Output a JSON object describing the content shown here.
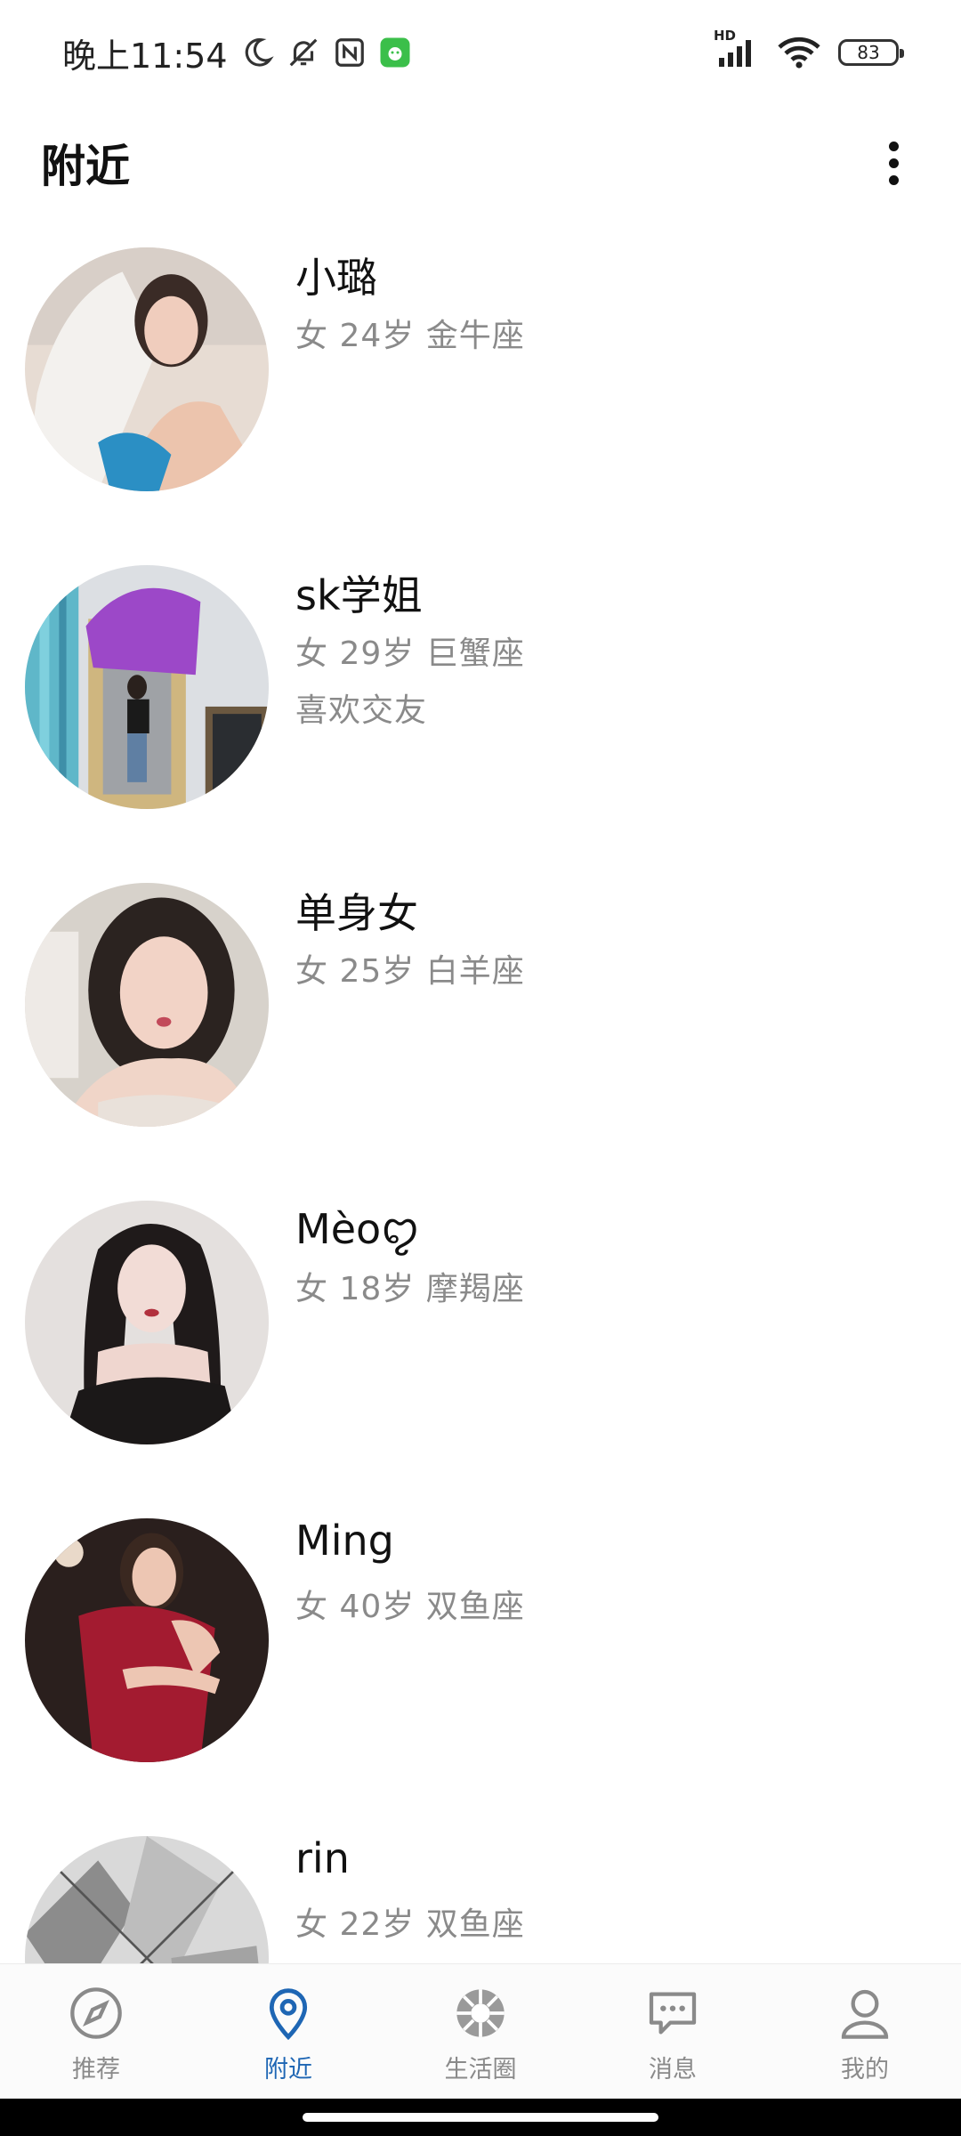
{
  "status_bar": {
    "time": "晚上11:54",
    "network_label": "HD",
    "battery_level": "83",
    "icons": [
      "moon-icon",
      "bell-off-icon",
      "nfc-icon",
      "app-notification-icon",
      "signal-icon",
      "wifi-icon",
      "battery-icon"
    ]
  },
  "header": {
    "title": "附近",
    "menu_icon": "more-vertical-icon"
  },
  "users": [
    {
      "name": "小璐",
      "meta": "女 24岁 金牛座",
      "bio": ""
    },
    {
      "name": "sk学姐",
      "meta": "女 29岁 巨蟹座",
      "bio": "喜欢交友"
    },
    {
      "name": " 单身女",
      "meta": "女 25岁 白羊座",
      "bio": ""
    },
    {
      "name": "Mèoꨄ︎",
      "meta": "女 18岁 摩羯座",
      "bio": ""
    },
    {
      "name": "Ming",
      "meta": "女 40岁 双鱼座",
      "bio": ""
    },
    {
      "name": "rin",
      "meta": "女 22岁 双鱼座",
      "bio": ""
    }
  ],
  "bottom_nav": {
    "items": [
      {
        "label": "推荐",
        "icon": "compass-icon",
        "active": false
      },
      {
        "label": "附近",
        "icon": "location-pin-icon",
        "active": true
      },
      {
        "label": "生活圈",
        "icon": "aperture-icon",
        "active": false
      },
      {
        "label": "消息",
        "icon": "chat-bubble-icon",
        "active": false
      },
      {
        "label": "我的",
        "icon": "user-icon",
        "active": false
      }
    ]
  },
  "colors": {
    "accent": "#1e66b4",
    "inactive": "#8a8a8a",
    "text": "#111111",
    "secondary_text": "#8a8a8a"
  }
}
